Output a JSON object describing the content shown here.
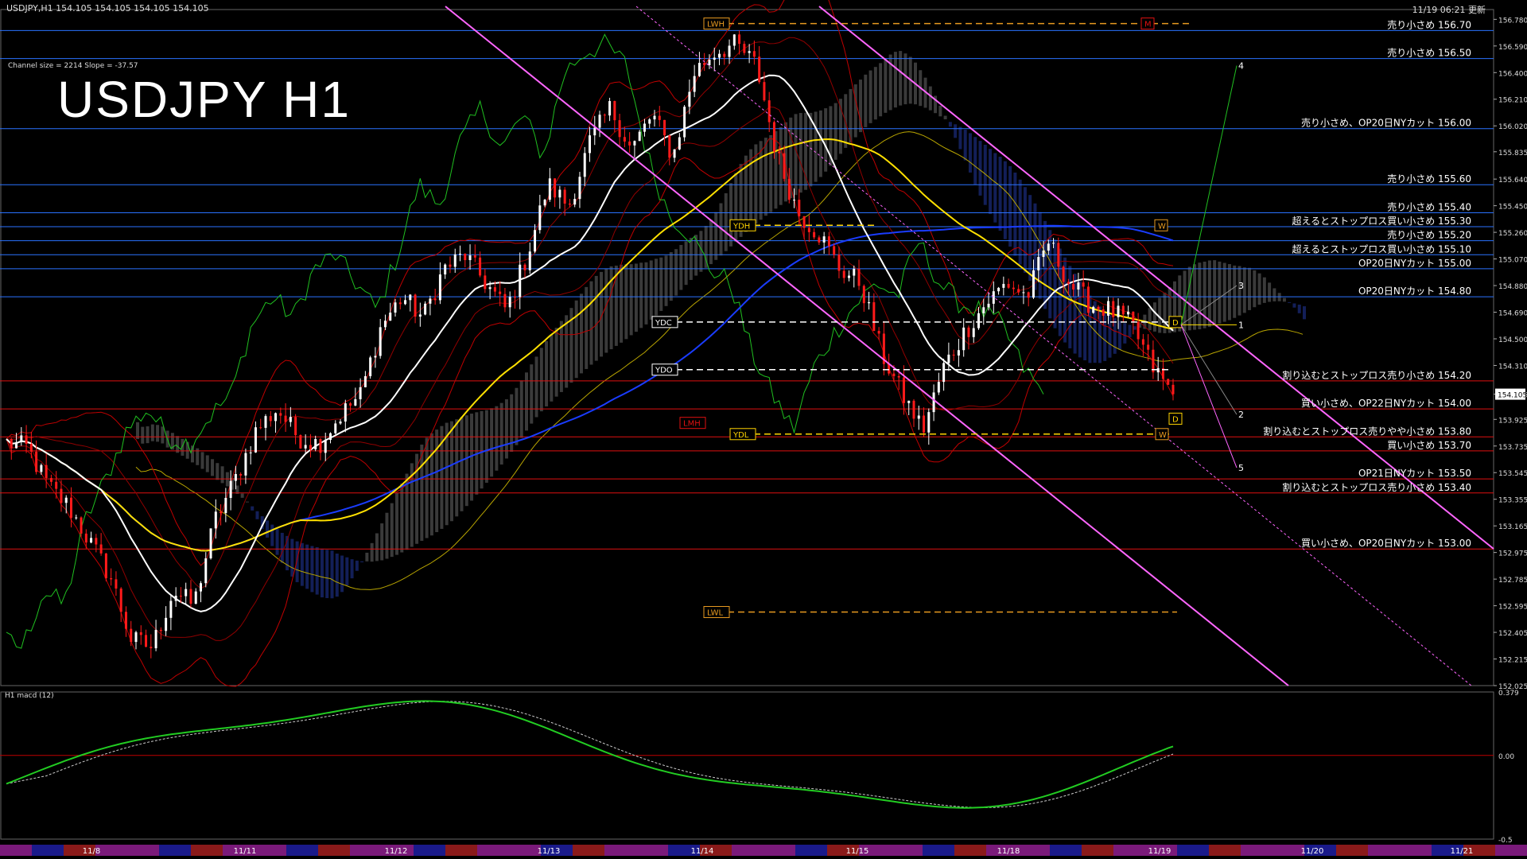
{
  "header": {
    "symbol_info": "USDJPY,H1  154.105 154.105 154.105 154.105",
    "timestamp": "11/19 06:21 更新",
    "channel_info": "Channel size = 2214 Slope = -37.57",
    "big_title": "USDJPY H1",
    "macd_label": "H1  macd (12)"
  },
  "chart_data": [
    {
      "type": "candlestick",
      "title": "USDJPY H1",
      "ylim": [
        152.025,
        156.85
      ],
      "y_ticks": [
        "156.780",
        "156.590",
        "156.400",
        "156.210",
        "156.020",
        "155.835",
        "155.640",
        "155.450",
        "155.260",
        "155.070",
        "154.880",
        "154.690",
        "154.500",
        "154.310",
        "154.105",
        "153.925",
        "153.735",
        "153.545",
        "153.355",
        "153.165",
        "152.975",
        "152.785",
        "152.595",
        "152.405",
        "152.215",
        "152.025"
      ],
      "current_price": "154.105",
      "x_labels": [
        "11/8",
        "11/11",
        "11/12",
        "11/13",
        "11/14",
        "11/15",
        "11/18",
        "11/19",
        "11/20",
        "11/21"
      ],
      "close_path": [
        153.76,
        153.72,
        153.45,
        153.3,
        153.05,
        152.8,
        152.35,
        152.3,
        152.7,
        152.6,
        153.2,
        153.5,
        153.85,
        154.0,
        153.8,
        153.75,
        153.95,
        154.1,
        154.6,
        154.8,
        154.65,
        155.0,
        155.1,
        154.9,
        154.7,
        155.1,
        155.6,
        155.45,
        155.9,
        156.15,
        155.85,
        156.1,
        155.8,
        156.4,
        156.55,
        156.6,
        156.45,
        155.8,
        155.4,
        155.25,
        155.0,
        154.9,
        154.4,
        154.1,
        153.85,
        154.3,
        154.55,
        154.75,
        154.9,
        154.8,
        155.2,
        154.9,
        154.75,
        154.7,
        154.6,
        154.3,
        154.105
      ],
      "price_levels": [
        {
          "price": 156.7,
          "label": "売り小さめ 156.70",
          "color": "#2a72ff"
        },
        {
          "price": 156.5,
          "label": "売り小さめ 156.50",
          "color": "#2a72ff"
        },
        {
          "price": 156.0,
          "label": "売り小さめ、OP20日NYカット 156.00",
          "color": "#2a72ff"
        },
        {
          "price": 155.6,
          "label": "売り小さめ 155.60",
          "color": "#2a72ff"
        },
        {
          "price": 155.4,
          "label": "売り小さめ 155.40",
          "color": "#2a72ff"
        },
        {
          "price": 155.3,
          "label": "超えるとストップロス買い小さめ 155.30",
          "color": "#2a72ff"
        },
        {
          "price": 155.2,
          "label": "売り小さめ 155.20",
          "color": "#2a72ff"
        },
        {
          "price": 155.1,
          "label": "超えるとストップロス買い小さめ 155.10",
          "color": "#2a72ff"
        },
        {
          "price": 155.0,
          "label": "OP20日NYカット 155.00",
          "color": "#2a72ff"
        },
        {
          "price": 154.8,
          "label": "OP20日NYカット 154.80",
          "color": "#2a72ff"
        },
        {
          "price": 154.2,
          "label": "割り込むとストップロス売り小さめ 154.20",
          "color": "#e01010"
        },
        {
          "price": 154.0,
          "label": "買い小さめ、OP22日NYカット 154.00",
          "color": "#e01010"
        },
        {
          "price": 153.8,
          "label": "割り込むとストップロス売りやや小さめ 153.80",
          "color": "#e01010"
        },
        {
          "price": 153.7,
          "label": "買い小さめ 153.70",
          "color": "#e01010"
        },
        {
          "price": 153.5,
          "label": "OP21日NYカット 153.50",
          "color": "#e01010"
        },
        {
          "price": 153.4,
          "label": "割り込むとストップロス売り小さめ 153.40",
          "color": "#e01010"
        },
        {
          "price": 153.0,
          "label": "買い小さめ、OP20日NYカット 153.00",
          "color": "#e01010"
        }
      ],
      "reference_labels": [
        {
          "label": "LWH",
          "price": 156.75,
          "color": "#e89a20"
        },
        {
          "label": "M",
          "price": 156.75,
          "color": "#e01010"
        },
        {
          "label": "YDH",
          "price": 155.31,
          "color": "#ffd400"
        },
        {
          "label": "W",
          "price": 155.31,
          "color": "#e89a20"
        },
        {
          "label": "YDC",
          "price": 154.62,
          "color": "#ffffff"
        },
        {
          "label": "D",
          "price": 154.62,
          "color": "#ffd400"
        },
        {
          "label": "YDO",
          "price": 154.28,
          "color": "#ffffff"
        },
        {
          "label": "LMH",
          "price": 153.9,
          "color": "#e01010"
        },
        {
          "label": "D",
          "price": 153.93,
          "color": "#ffd400"
        },
        {
          "label": "YDL",
          "price": 153.82,
          "color": "#ffd400"
        },
        {
          "label": "W",
          "price": 153.82,
          "color": "#e89a20"
        },
        {
          "label": "LWL",
          "price": 152.55,
          "color": "#e89a20"
        }
      ],
      "projection_labels": [
        "4",
        "3",
        "1",
        "2",
        "5"
      ],
      "colors": {
        "up": "#ffffff",
        "down": "#ff1a1a",
        "ma_white": "#ffffff",
        "ma_yellow": "#ffe000",
        "ma_blue": "#1a3cff",
        "green": "#20c020",
        "magenta": "#ff66ff"
      }
    },
    {
      "type": "line",
      "title": "H1  macd (12)",
      "ylim": [
        -0.5,
        0.379
      ],
      "y_ticks": [
        "0.379",
        "0.00",
        "-0.5"
      ],
      "series": []
    }
  ]
}
